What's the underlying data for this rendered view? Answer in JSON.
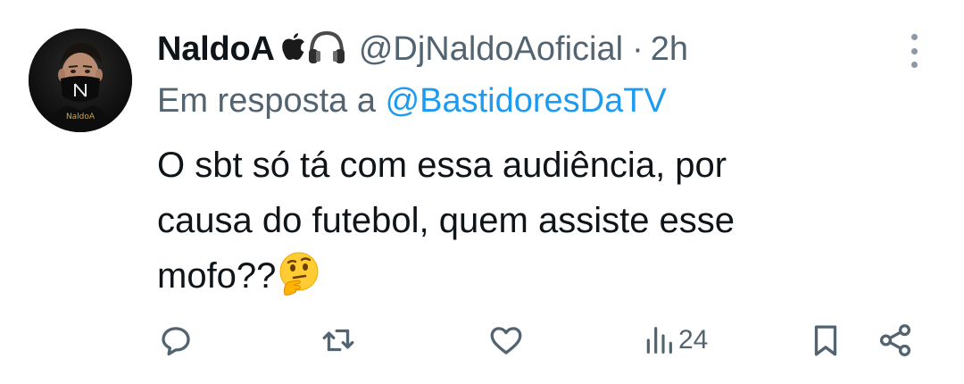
{
  "author": {
    "display_name": "NaldoA",
    "name_emojis": [
      "apple-icon",
      "headphones-icon"
    ],
    "handle": "@DjNaldoAoficial",
    "separator": "·",
    "time": "2h",
    "avatar_text": "NaldoA"
  },
  "reply_context": {
    "prefix": "Em resposta a",
    "mention": "@BastidoresDaTV"
  },
  "tweet": {
    "line1": "O sbt só tá com essa audiência, por",
    "line2": "causa do futebol, quem assiste esse",
    "line3": "mofo??",
    "emoji": "thinking-face-icon"
  },
  "actions": {
    "reply": "reply-icon",
    "retweet": "retweet-icon",
    "like": "like-icon",
    "views_count": "24",
    "bookmark": "bookmark-icon",
    "share": "share-icon"
  },
  "colors": {
    "text": "#0f1419",
    "secondary": "#536471",
    "link": "#1d9bf0"
  }
}
